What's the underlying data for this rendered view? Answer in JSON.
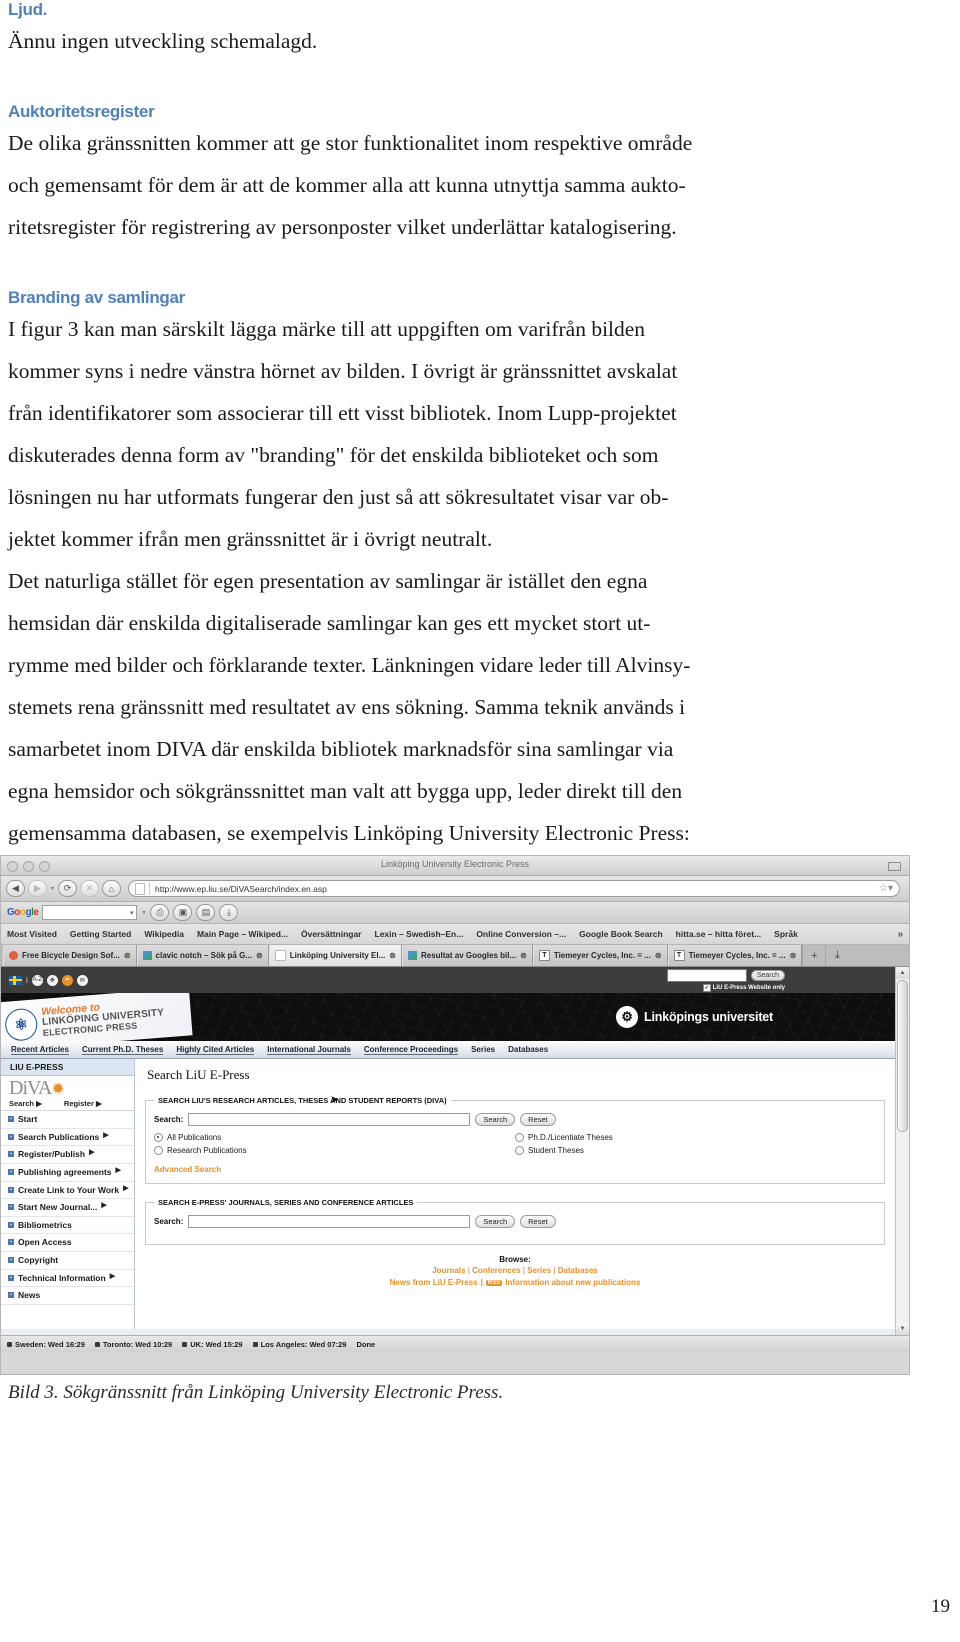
{
  "document": {
    "section_ljud": {
      "heading": "Ljud.",
      "body": "Ännu ingen utveckling schemalagd."
    },
    "section_auktoritetsregister": {
      "heading": "Auktoritetsregister",
      "lines": [
        "De olika gränssnitten kommer att ge stor funktionalitet inom respektive område",
        "och gemensamt för dem är att de kommer alla att kunna utnyttja samma aukto-",
        "ritetsregister för registrering av personposter vilket underlättar katalogisering."
      ]
    },
    "section_branding": {
      "heading": "Branding av samlingar",
      "lines": [
        "I figur 3 kan man särskilt lägga märke till att uppgiften om varifrån bilden",
        "kommer syns i nedre vänstra hörnet av bilden. I övrigt är gränssnittet avskalat",
        "från identifikatorer som associerar till ett visst bibliotek. Inom Lupp-projektet",
        "diskuterades denna form av \"branding\" för det enskilda biblioteket och som",
        "lösningen nu har utformats fungerar den just så att sökresultatet visar var ob-",
        "jektet kommer ifrån men gränssnittet är i övrigt neutralt."
      ]
    },
    "section_natural": {
      "lines": [
        "Det naturliga stället för egen presentation av samlingar är istället den egna",
        "hemsidan där enskilda digitaliserade samlingar kan ges ett mycket stort ut-",
        "rymme med bilder och förklarande texter. Länkningen vidare leder till Alvinsy-",
        "stemets rena gränssnitt med resultatet av ens sökning. Samma teknik används i",
        "samarbetet inom DIVA där enskilda bibliotek marknadsför sina samlingar via",
        "egna hemsidor och sökgränssnittet man valt att bygga upp, leder direkt till den",
        "gemensamma databasen, se exempelvis Linköping University Electronic Press:"
      ]
    },
    "caption": "Bild 3. Sökgränssnitt från Linköping University Electronic Press.",
    "page_number": "19",
    "accent_heading_color": "#4f81bd"
  },
  "browser": {
    "window_title": "Linköping University Electronic Press",
    "toolbar": {
      "back_icon": "back-arrow-icon",
      "forward_icon": "forward-arrow-icon",
      "reload_icon": "reload-icon",
      "stop_icon": "stop-icon",
      "home_icon": "home-icon",
      "url": "http://www.ep.liu.se/DiVASearch/index.en.asp",
      "bookmark_star_icon": "star-icon"
    },
    "googlebar": {
      "logo": "Google",
      "search_value": "",
      "buttons": [
        "print-icon",
        "image-icon",
        "save-icon",
        "download-icon"
      ]
    },
    "bookmarks": [
      "Most Visited",
      "Getting Started",
      "Wikipedia",
      "Main Page – Wikiped...",
      "Översättningar",
      "Lexin – Swedish–En...",
      "Online Conversion –...",
      "Google Book Search",
      "hitta.se – hitta föret...",
      "Språk"
    ],
    "bookmarks_overflow": "»",
    "tabs": [
      {
        "label": "Free Bicycle Design Sof...",
        "active": false
      },
      {
        "label": "clavic notch – Sök på G...",
        "active": false
      },
      {
        "label": "Linköping University El...",
        "active": true
      },
      {
        "label": "Resultat av Googles bil...",
        "active": false
      },
      {
        "label": "Tiemeyer Cycles, Inc. = ...",
        "active": false
      },
      {
        "label": "Tiemeyer Cycles, Inc. = ...",
        "active": false
      }
    ],
    "new_tab_label": "+",
    "statusbar": [
      "Sweden: Wed 16:29",
      "Toronto: Wed 10:29",
      "UK: Wed 15:29",
      "Los Angeles: Wed 07:29",
      "Done"
    ]
  },
  "site": {
    "topbar": {
      "flag_icon": "swedish-flag-icon",
      "info_icon": "info-icon",
      "az_icon": "a-to-z-icon",
      "move_icon": "move-icon",
      "chart_icon": "chart-icon",
      "mail_icon": "mail-icon",
      "search_value": "",
      "search_button": "Search",
      "checkbox_label": "LiU E-Press Website only",
      "checkbox_checked": true
    },
    "banner": {
      "welcome_line1": "Welcome to",
      "welcome_line2": "LINKÖPING UNIVERSITY",
      "welcome_line3": "ELECTRONIC PRESS",
      "brand": "Linköpings universitet",
      "seal_icon": "liu-seal-icon"
    },
    "navtabs": [
      "Recent Articles",
      "Current Ph.D. Theses",
      "Highly Cited Articles",
      "International Journals",
      "Conference Proceedings",
      "Series",
      "Databases"
    ],
    "sidebar": {
      "header": "LIU E-PRESS",
      "logo_text": "DiVA",
      "logo_star": "✹",
      "logo_links": [
        "Search ▶",
        "Register ▶"
      ],
      "items": [
        {
          "label": "Start",
          "arrow": false
        },
        {
          "label": "Search Publications",
          "arrow": true
        },
        {
          "label": "Register/Publish",
          "arrow": true
        },
        {
          "label": "Publishing agreements",
          "arrow": true
        },
        {
          "label": "Create Link to Your Work",
          "arrow": true
        },
        {
          "label": "Start New Journal...",
          "arrow": true
        },
        {
          "label": "Bibliometrics",
          "arrow": false
        },
        {
          "label": "Open Access",
          "arrow": false
        },
        {
          "label": "Copyright",
          "arrow": false
        },
        {
          "label": "Technical Information",
          "arrow": true
        },
        {
          "label": "News",
          "arrow": false
        }
      ]
    },
    "main": {
      "title": "Search LiU E-Press",
      "form1": {
        "legend": "SEARCH LIU'S RESEARCH ARTICLES, THESES AND STUDENT REPORTS (DIVA)",
        "search_label": "Search:",
        "search_value": "",
        "search_button": "Search",
        "reset_button": "Reset",
        "options": [
          {
            "label": "All Publications",
            "selected": true
          },
          {
            "label": "Ph.D./Licentiate Theses",
            "selected": false
          },
          {
            "label": "Research Publications",
            "selected": false
          },
          {
            "label": "Student Theses",
            "selected": false
          }
        ],
        "advanced_link": "Advanced Search"
      },
      "form2": {
        "legend": "SEARCH E-PRESS' JOURNALS, SERIES AND CONFERENCE ARTICLES",
        "search_label": "Search:",
        "search_value": "",
        "search_button": "Search",
        "reset_button": "Reset"
      },
      "browse": {
        "title": "Browse:",
        "links": [
          "Journals",
          "Conferences",
          "Series",
          "Databases"
        ],
        "news_link": "News from LiU E-Press",
        "rss_label": "RSS",
        "info_link": "Information about new publications"
      }
    }
  }
}
